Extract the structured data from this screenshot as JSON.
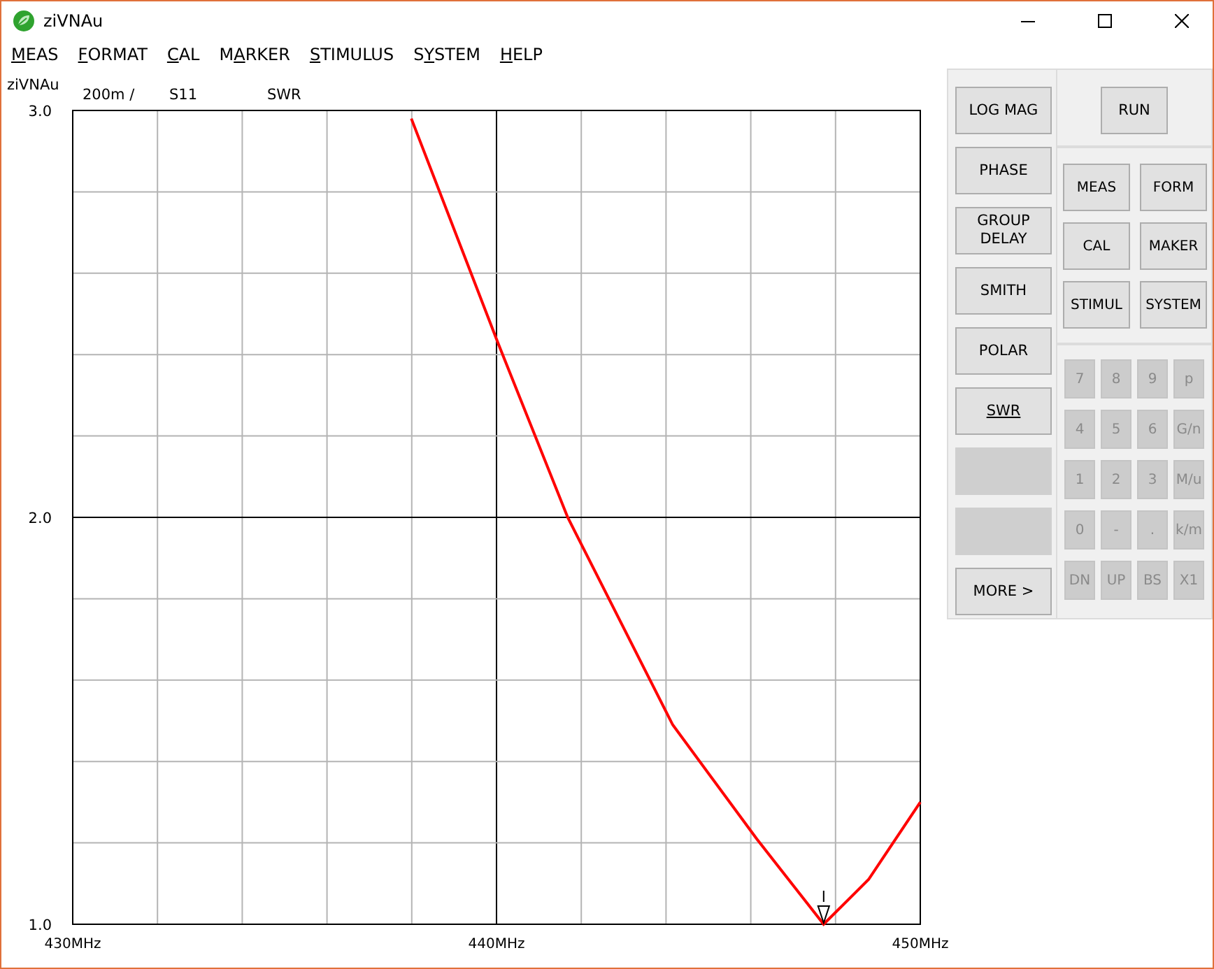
{
  "window": {
    "title": "ziVNAu"
  },
  "menu": [
    {
      "key": "M",
      "post": "EAS"
    },
    {
      "key": "F",
      "post": "ORMAT"
    },
    {
      "key": "C",
      "post": "AL"
    },
    {
      "pre": "M",
      "key": "A",
      "post": "RKER"
    },
    {
      "key": "S",
      "post": "TIMULUS"
    },
    {
      "pre": "S",
      "key": "Y",
      "post": "STEM"
    },
    {
      "key": "H",
      "post": "ELP"
    }
  ],
  "plot": {
    "app_label": "ziVNAu",
    "scale": "200m /",
    "parameter": "S11",
    "format": "SWR",
    "chart_data": {
      "type": "line",
      "x": [
        437.99,
        440.03,
        441.68,
        444.16,
        446.14,
        447.72,
        448.78,
        450.0
      ],
      "series": [
        {
          "color": "#ff0000",
          "values": [
            2.98,
            2.43,
            2.0,
            1.49,
            1.21,
            1.0,
            1.11,
            1.3
          ]
        }
      ],
      "xlim": [
        430,
        450
      ],
      "ylim": [
        1.0,
        3.0
      ],
      "xticks": [
        {
          "value": 430,
          "label": "430MHz"
        },
        {
          "value": 440,
          "label": "440MHz"
        },
        {
          "value": 450,
          "label": "450MHz"
        }
      ],
      "yticks": [
        {
          "value": 1.0,
          "label": "1.0"
        },
        {
          "value": 2.0,
          "label": "2.0"
        },
        {
          "value": 3.0,
          "label": "3.0"
        }
      ]
    }
  },
  "format_buttons": [
    {
      "kind": "button",
      "label": "LOG MAG",
      "selected": false
    },
    {
      "kind": "button",
      "label": "PHASE",
      "selected": false
    },
    {
      "kind": "button",
      "label": "GROUP DELAY",
      "selected": false
    },
    {
      "kind": "button",
      "label": "SMITH",
      "selected": false
    },
    {
      "kind": "button",
      "label": "POLAR",
      "selected": false
    },
    {
      "kind": "button",
      "label": "SWR",
      "selected": true
    },
    {
      "kind": "blank"
    },
    {
      "kind": "blank"
    },
    {
      "kind": "button",
      "label": "MORE >",
      "selected": false
    }
  ],
  "run_button": "RUN",
  "menu_buttons": [
    "MEAS",
    "FORM",
    "CAL",
    "MAKER",
    "STIMUL",
    "SYSTEM"
  ],
  "keypad": [
    {
      "label": "7",
      "disabled": true
    },
    {
      "label": "8",
      "disabled": true
    },
    {
      "label": "9",
      "disabled": true
    },
    {
      "label": "p",
      "disabled": true
    },
    {
      "label": "4",
      "disabled": true
    },
    {
      "label": "5",
      "disabled": true
    },
    {
      "label": "6",
      "disabled": true
    },
    {
      "label": "G/n",
      "disabled": true
    },
    {
      "label": "1",
      "disabled": true
    },
    {
      "label": "2",
      "disabled": true
    },
    {
      "label": "3",
      "disabled": true
    },
    {
      "label": "M/u",
      "disabled": true
    },
    {
      "label": "0",
      "disabled": true
    },
    {
      "label": "-",
      "disabled": true
    },
    {
      "label": ".",
      "disabled": true
    },
    {
      "label": "k/m",
      "disabled": true
    },
    {
      "label": "DN",
      "disabled": true
    },
    {
      "label": "UP",
      "disabled": true
    },
    {
      "label": "BS",
      "disabled": true
    },
    {
      "label": "X1",
      "disabled": true
    }
  ]
}
